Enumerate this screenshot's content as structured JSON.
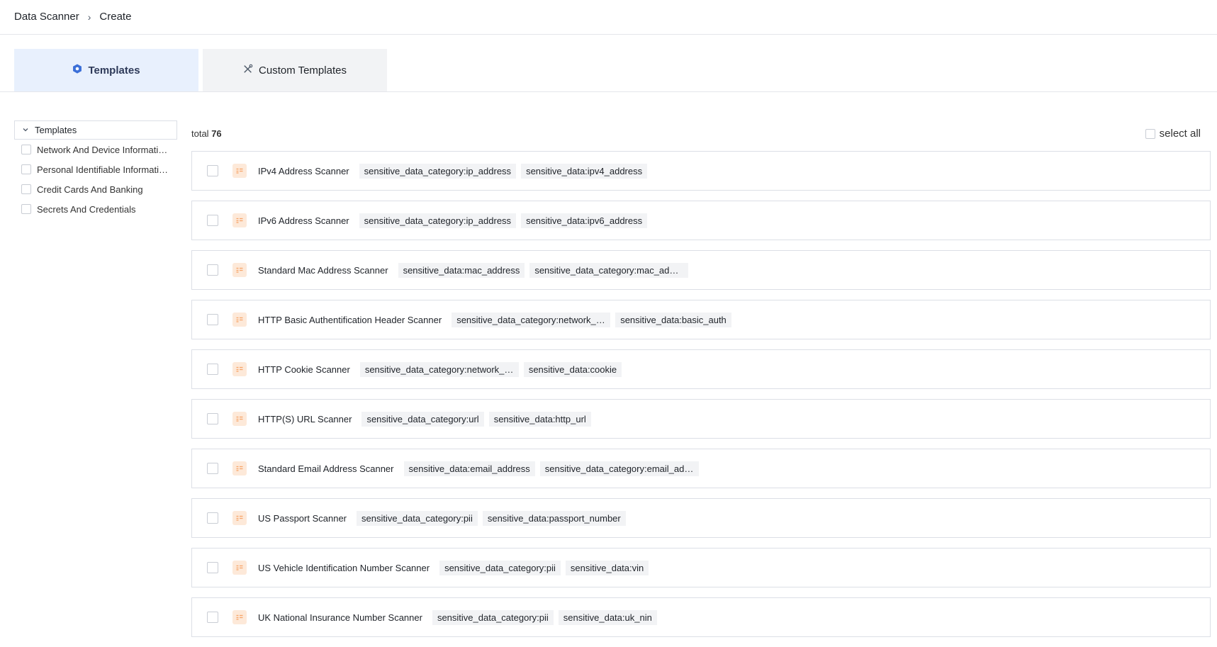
{
  "breadcrumb": {
    "parent": "Data Scanner",
    "current": "Create"
  },
  "tabs": [
    {
      "label": "Templates",
      "icon": "hexagon-icon",
      "active": true
    },
    {
      "label": "Custom Templates",
      "icon": "tools-icon",
      "active": false
    }
  ],
  "sidebar": {
    "title": "Templates",
    "items": [
      {
        "label": "Network And Device Information"
      },
      {
        "label": "Personal Identifiable Information"
      },
      {
        "label": "Credit Cards And Banking"
      },
      {
        "label": "Secrets And Credentials"
      }
    ]
  },
  "list": {
    "total_label": "total",
    "total": "76",
    "select_all": "select all",
    "rows": [
      {
        "name": "IPv4 Address Scanner",
        "tags": [
          "sensitive_data_category:ip_address",
          "sensitive_data:ipv4_address"
        ]
      },
      {
        "name": "IPv6 Address Scanner",
        "tags": [
          "sensitive_data_category:ip_address",
          "sensitive_data:ipv6_address"
        ]
      },
      {
        "name": "Standard Mac Address Scanner",
        "tags": [
          "sensitive_data:mac_address",
          "sensitive_data_category:mac_address"
        ]
      },
      {
        "name": "HTTP Basic Authentification Header Scanner",
        "tags": [
          "sensitive_data_category:network_and_device_info",
          "sensitive_data:basic_auth"
        ]
      },
      {
        "name": "HTTP Cookie Scanner",
        "tags": [
          "sensitive_data_category:network_and_device_info",
          "sensitive_data:cookie"
        ]
      },
      {
        "name": "HTTP(S) URL Scanner",
        "tags": [
          "sensitive_data_category:url",
          "sensitive_data:http_url"
        ]
      },
      {
        "name": "Standard Email Address Scanner",
        "tags": [
          "sensitive_data:email_address",
          "sensitive_data_category:email_address"
        ]
      },
      {
        "name": "US Passport Scanner",
        "tags": [
          "sensitive_data_category:pii",
          "sensitive_data:passport_number"
        ]
      },
      {
        "name": "US Vehicle Identification Number Scanner",
        "tags": [
          "sensitive_data_category:pii",
          "sensitive_data:vin"
        ]
      },
      {
        "name": "UK National Insurance Number Scanner",
        "tags": [
          "sensitive_data_category:pii",
          "sensitive_data:uk_nin"
        ]
      }
    ]
  },
  "colors": {
    "active_tab_bg": "#e8f0fd",
    "accent": "#3b6fd8",
    "row_icon": "#f7a66a"
  }
}
